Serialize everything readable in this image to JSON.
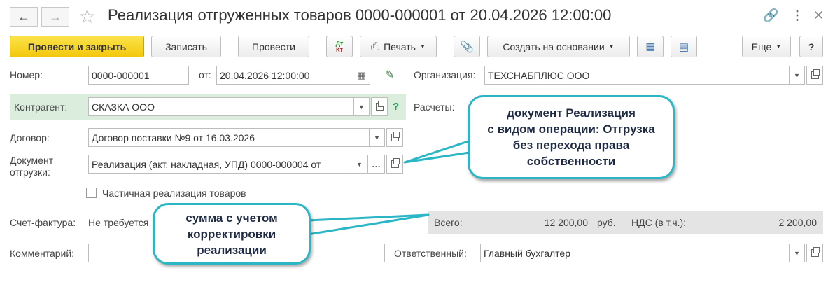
{
  "header": {
    "title": "Реализация отгруженных товаров 0000-000001 от 20.04.2026 12:00:00"
  },
  "toolbar": {
    "post_close": "Провести и закрыть",
    "save": "Записать",
    "post": "Провести",
    "dtkt_top": "Дт",
    "dtkt_bottom": "Кт",
    "print": "Печать",
    "create_based": "Создать на основании",
    "more": "Еще",
    "help": "?"
  },
  "form": {
    "number_label": "Номер:",
    "number_value": "0000-000001",
    "date_label": "от:",
    "date_value": "20.04.2026 12:00:00",
    "org_label": "Организация:",
    "org_value": "ТЕХСНАБПЛЮС ООО",
    "counterparty_label": "Контрагент:",
    "counterparty_value": "СКАЗКА ООО",
    "settlements_label": "Расчеты:",
    "contract_label": "Договор:",
    "contract_value": "Договор поставки №9 от 16.03.2026",
    "shipment_label_1": "Документ",
    "shipment_label_2": "отгрузки:",
    "shipment_value": "Реализация (акт, накладная, УПД) 0000-000004 от",
    "partial_label": "Частичная реализация товаров",
    "invoice_label": "Счет-фактура:",
    "invoice_value": "Не требуется",
    "total_label": "Всего:",
    "total_value": "12 200,00",
    "currency": "руб.",
    "vat_label": "НДС (в т.ч.):",
    "vat_value": "2 200,00",
    "comment_label": "Комментарий:",
    "comment_value": "",
    "responsible_label": "Ответственный:",
    "responsible_value": "Главный бухгалтер"
  },
  "callouts": {
    "top_line1": "документ Реализация",
    "top_line2": "с видом операции: Отгрузка",
    "top_line3": "без перехода права",
    "top_line4": "собственности",
    "bottom_line1": "сумма с учетом",
    "bottom_line2": "корректировки",
    "bottom_line3": "реализации"
  },
  "colors": {
    "accent_yellow": "#f3c80c",
    "callout_border": "#2bb6c6",
    "counterparty_bg": "#dbeedd",
    "totals_bg": "#e4e4e4"
  }
}
